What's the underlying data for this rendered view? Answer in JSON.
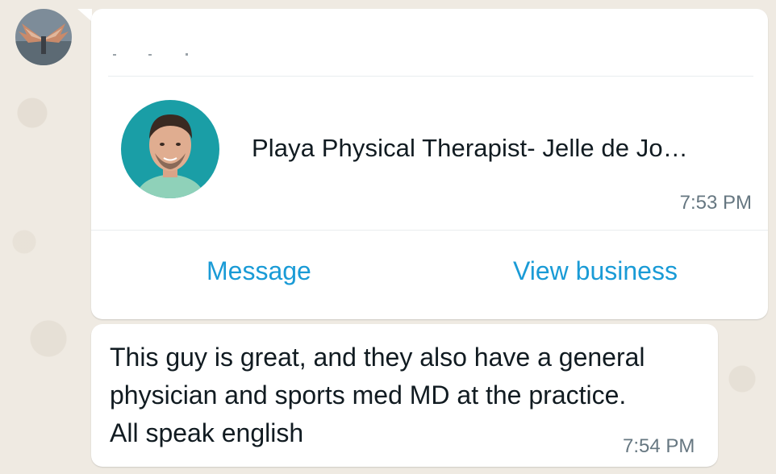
{
  "chat": {
    "business_card": {
      "name": "Playa Physical Therapist- Jelle de Jo…",
      "time": "7:53 PM",
      "actions": {
        "message_label": "Message",
        "view_business_label": "View business"
      }
    },
    "message": {
      "text": "This guy is great, and they also have a general\nphysician and sports med MD at the practice.\nAll speak english",
      "time": "7:54 PM"
    }
  },
  "colors": {
    "background": "#efeae2",
    "bubble": "#ffffff",
    "link": "#1a9bd6",
    "timestamp": "#667781"
  }
}
